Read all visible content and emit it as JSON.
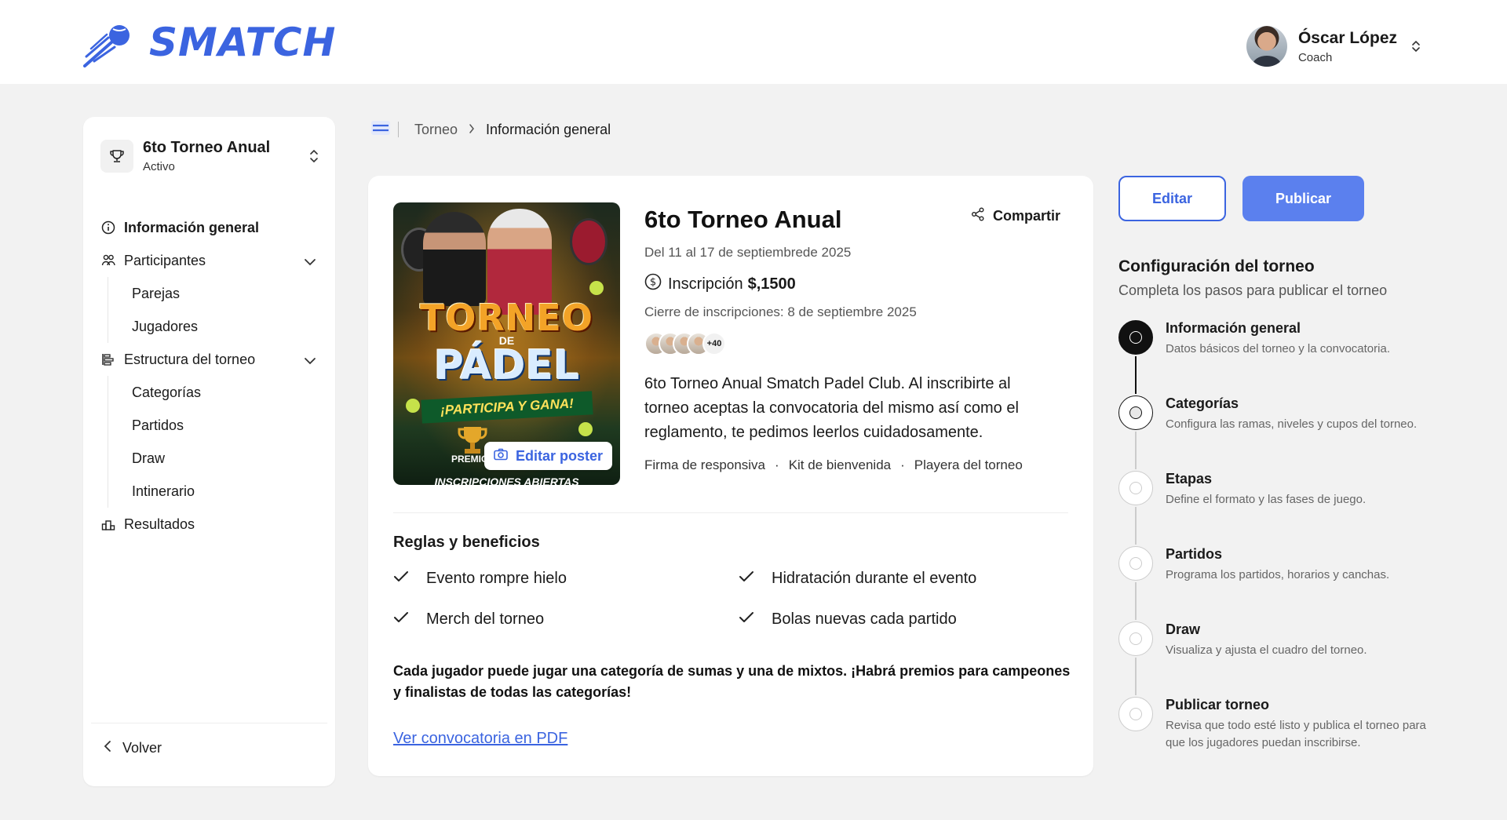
{
  "brand": {
    "name": "SMATCH",
    "color": "#3b64e0"
  },
  "user": {
    "name": "Óscar López",
    "role": "Coach"
  },
  "sidebar": {
    "tournament": {
      "name": "6to Torneo Anual",
      "status": "Activo"
    },
    "items": [
      {
        "label": "Información general",
        "icon": "info-icon",
        "active": true
      },
      {
        "label": "Participantes",
        "icon": "users-icon",
        "expandable": true,
        "children": [
          "Parejas",
          "Jugadores"
        ]
      },
      {
        "label": "Estructura del torneo",
        "icon": "structure-icon",
        "expandable": true,
        "children": [
          "Categorías",
          "Partidos",
          "Draw",
          "Intinerario"
        ]
      },
      {
        "label": "Resultados",
        "icon": "podium-icon"
      }
    ],
    "back_label": "Volver"
  },
  "breadcrumb": {
    "parent": "Torneo",
    "current": "Información general"
  },
  "event": {
    "title": "6to Torneo Anual",
    "share_label": "Compartir",
    "dates": "Del 11 al 17 de septiembrede 2025",
    "fee_label": "Inscripción",
    "fee_amount": "$,1500",
    "close_registration": "Cierre de inscripciones: 8 de septiembre 2025",
    "more_participants": "+40",
    "description": "6to Torneo Anual Smatch Padel Club. Al inscribirte al torneo aceptas la convocatoria del mismo así como el reglamento, te pedimos leerlos cuidadosamente.",
    "perks": [
      "Firma de responsiva",
      "Kit de bienvenida",
      "Playera del torneo"
    ],
    "edit_poster_label": "Editar poster",
    "poster": {
      "title_top": "TORNEO",
      "title_de": "DE",
      "title_bottom": "PÁDEL",
      "ribbon": "¡PARTICIPA Y GANA!",
      "premio": "PREMIO",
      "footer": "INSCRIPCIONES ABIERTAS"
    }
  },
  "rules": {
    "title": "Reglas y beneficios",
    "items": [
      "Evento rompre hielo",
      "Hidratación durante el evento",
      "Merch del torneo",
      "Bolas nuevas cada partido"
    ],
    "note": "Cada jugador puede jugar una categoría de sumas y una de mixtos. ¡Habrá premios para campeones y finalistas de todas las categorías!",
    "pdf_link": "Ver convocatoria en PDF"
  },
  "actions": {
    "edit": "Editar",
    "publish": "Publicar"
  },
  "config": {
    "title": "Configuración del torneo",
    "subtitle": "Completa los pasos para publicar el torneo",
    "steps": [
      {
        "name": "Información general",
        "desc": "Datos básicos del torneo y la convocatoria.",
        "state": "current"
      },
      {
        "name": "Categorías",
        "desc": "Configura las ramas, niveles y cupos del torneo.",
        "state": "next"
      },
      {
        "name": "Etapas",
        "desc": "Define el formato y las fases de juego.",
        "state": "pending"
      },
      {
        "name": "Partidos",
        "desc": "Programa los partidos, horarios y canchas.",
        "state": "pending"
      },
      {
        "name": "Draw",
        "desc": "Visualiza y ajusta el cuadro del torneo.",
        "state": "pending"
      },
      {
        "name": "Publicar torneo",
        "desc": "Revisa que todo esté listo y publica el torneo para que los jugadores puedan inscribirse.",
        "state": "pending"
      }
    ]
  }
}
